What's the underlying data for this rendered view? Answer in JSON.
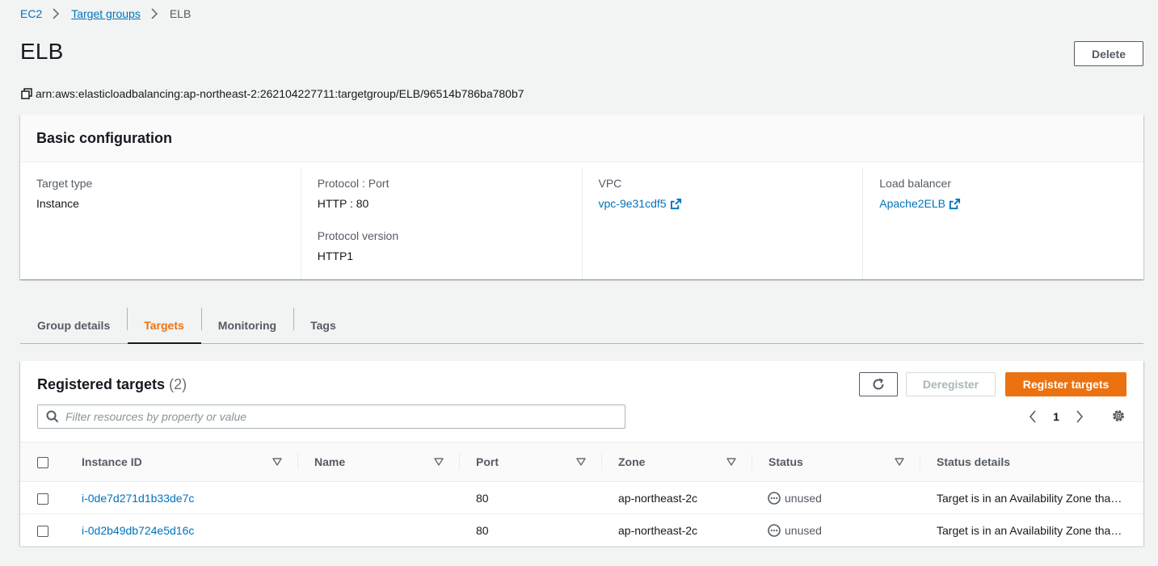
{
  "breadcrumb": {
    "items": [
      {
        "label": "EC2"
      },
      {
        "label": "Target groups"
      },
      {
        "label": "ELB"
      }
    ]
  },
  "page": {
    "title": "ELB",
    "delete_label": "Delete",
    "arn": "arn:aws:elasticloadbalancing:ap-northeast-2:262104227711:targetgroup/ELB/96514b786ba780b7"
  },
  "basic_config": {
    "heading": "Basic configuration",
    "target_type_label": "Target type",
    "target_type_value": "Instance",
    "protocol_port_label": "Protocol : Port",
    "protocol_port_value": "HTTP : 80",
    "protocol_version_label": "Protocol version",
    "protocol_version_value": "HTTP1",
    "vpc_label": "VPC",
    "vpc_value": "vpc-9e31cdf5",
    "lb_label": "Load balancer",
    "lb_value": "Apache2ELB"
  },
  "tabs": [
    {
      "label": "Group details",
      "active": false
    },
    {
      "label": "Targets",
      "active": true
    },
    {
      "label": "Monitoring",
      "active": false
    },
    {
      "label": "Tags",
      "active": false
    }
  ],
  "targets": {
    "title": "Registered targets",
    "count": "(2)",
    "deregister_label": "Deregister",
    "register_label": "Register targets",
    "filter_placeholder": "Filter resources by property or value",
    "page_number": "1",
    "columns": {
      "instance_id": "Instance ID",
      "name": "Name",
      "port": "Port",
      "zone": "Zone",
      "status": "Status",
      "status_details": "Status details"
    },
    "rows": [
      {
        "instance_id": "i-0de7d271d1b33de7c",
        "name": "",
        "port": "80",
        "zone": "ap-northeast-2c",
        "status": "unused",
        "status_details": "Target is in an Availability Zone that is not enabled for the load balancer"
      },
      {
        "instance_id": "i-0d2b49db724e5d16c",
        "name": "",
        "port": "80",
        "zone": "ap-northeast-2c",
        "status": "unused",
        "status_details": "Target is in an Availability Zone that is not enabled for the load balancer"
      }
    ]
  },
  "colors": {
    "accent": "#ec7211",
    "link": "#0073bb",
    "background": "#f2f3f3",
    "text": "#16191f",
    "secondary_text": "#545b64"
  }
}
